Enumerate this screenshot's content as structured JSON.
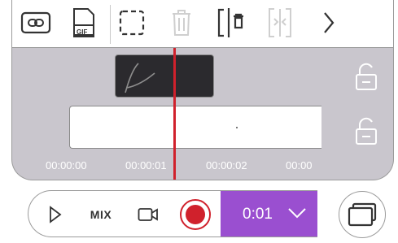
{
  "toolbar": {
    "gif_label": "GIF",
    "items": [
      "link-icon",
      "gif-icon",
      "select-icon",
      "trash-icon",
      "split-icon",
      "trim-icon",
      "chevron-right-icon"
    ]
  },
  "timeline": {
    "timestamps": [
      "00:00:00",
      "00:00:01",
      "00:00:02",
      "00:00"
    ],
    "locks": [
      "unlocked",
      "unlocked"
    ]
  },
  "bottom_bar": {
    "mix_label": "MIX",
    "duration": "0:01",
    "accent_color": "#9a4fd0",
    "record_color": "#d0212c"
  }
}
